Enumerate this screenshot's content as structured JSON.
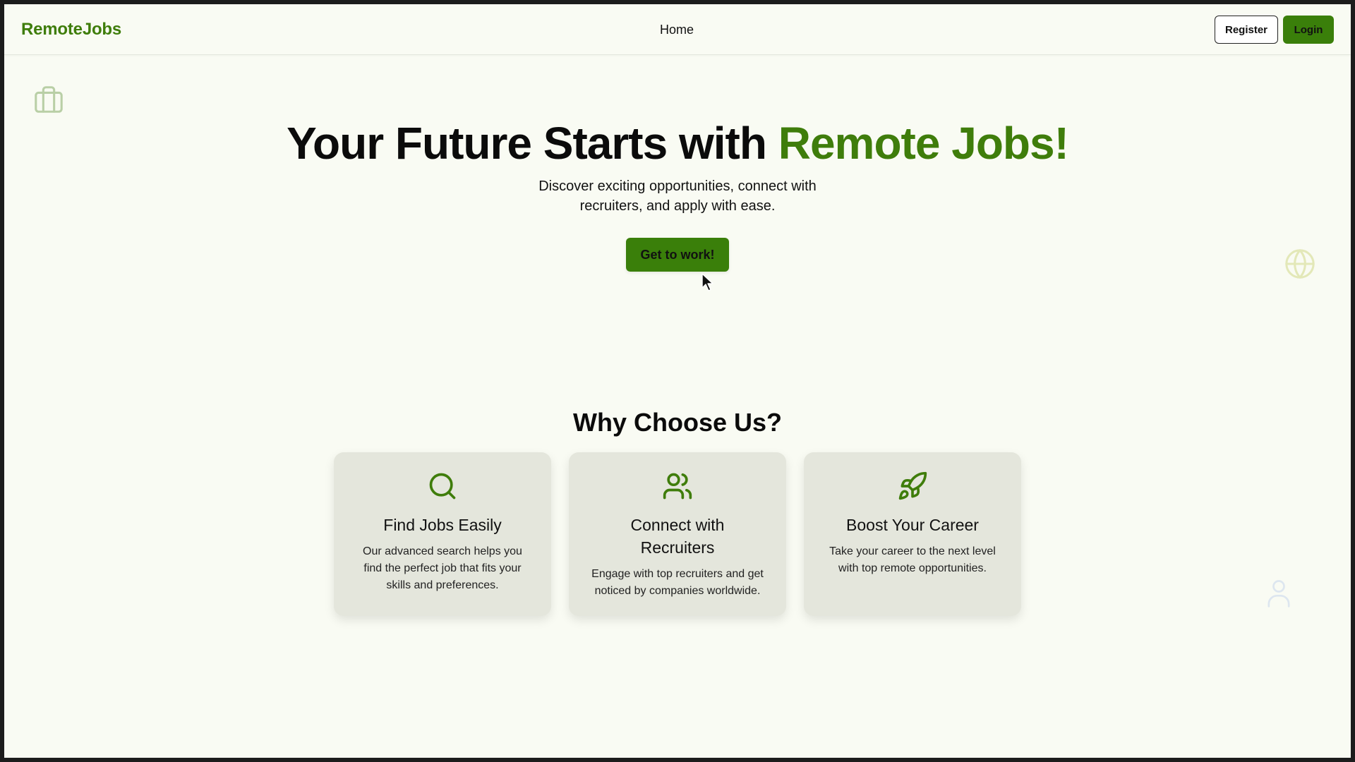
{
  "navbar": {
    "brand": "RemoteJobs",
    "home_link": "Home",
    "register_label": "Register",
    "login_label": "Login"
  },
  "hero": {
    "title_main": "Your Future Starts with ",
    "title_accent": "Remote Jobs!",
    "subtitle": "Discover exciting opportunities, connect with recruiters, and apply with ease.",
    "cta_label": "Get to work!"
  },
  "why": {
    "title": "Why Choose Us?",
    "cards": [
      {
        "icon": "search-icon",
        "title": "Find Jobs Easily",
        "description": "Our advanced search helps you find the perfect job that fits your skills and preferences."
      },
      {
        "icon": "users-icon",
        "title": "Connect with Recruiters",
        "description": "Engage with top recruiters and get noticed by companies worldwide."
      },
      {
        "icon": "rocket-icon",
        "title": "Boost Your Career",
        "description": "Take your career to the next level with top remote opportunities."
      }
    ]
  },
  "decorations": [
    "briefcase-icon",
    "globe-icon",
    "user-icon"
  ],
  "colors": {
    "accent": "#3f7d0b",
    "button": "#3a7f0a",
    "background": "#f9fbf3",
    "card": "#e4e6dc"
  }
}
